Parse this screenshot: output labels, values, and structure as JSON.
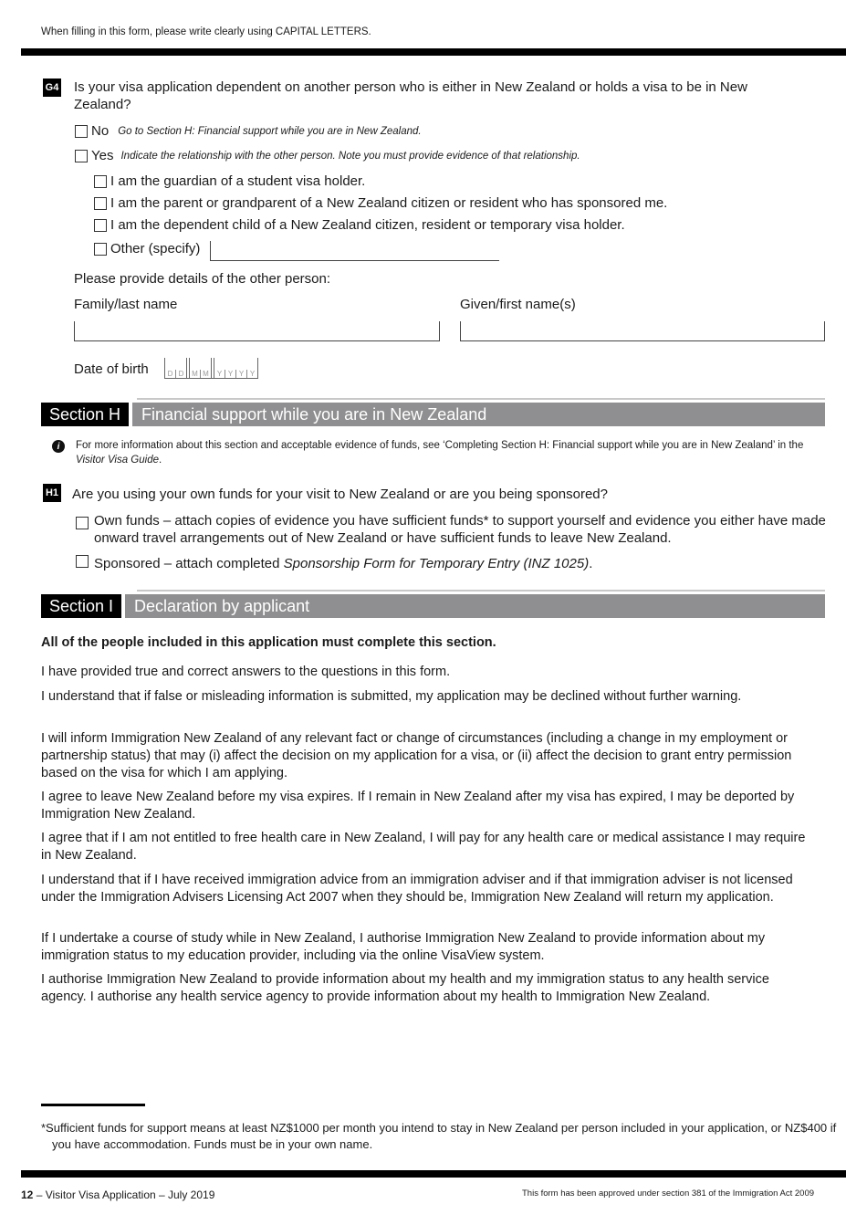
{
  "header": {
    "note": "When filling in this form, please write clearly using CAPITAL LETTERS."
  },
  "g4": {
    "badge": "G4",
    "question": "Is your visa application dependent on another person who is either in New Zealand or holds a visa to be in New Zealand?",
    "no_label": "No",
    "no_hint": "Go to Section H: Financial support while you are in New Zealand.",
    "yes_label": "Yes",
    "yes_hint": "Indicate the relationship with the other person. Note you must provide evidence of that relationship.",
    "options": [
      "I am the guardian of a student visa holder.",
      "I am the parent or grandparent of a New Zealand citizen or resident who has sponsored me.",
      "I am the dependent child of a New Zealand citizen, resident or temporary visa holder.",
      "Other (specify)"
    ],
    "other_value": "",
    "details_prompt": "Please provide details of the other person:",
    "family_name_label": "Family/last name",
    "family_name_value": "",
    "given_name_label": "Given/first name(s)",
    "given_name_value": "",
    "dob_label": "Date of birth",
    "dob_placeholders": [
      "D",
      "D",
      "M",
      "M",
      "Y",
      "Y",
      "Y",
      "Y"
    ]
  },
  "section_h": {
    "label": "Section H",
    "title": "Financial support while you are in New Zealand",
    "info_1": "For more information about this section and acceptable evidence of funds, see ‘Completing Section H: Financial support while you are in New Zealand’ in the ",
    "info_guide": "Visitor Visa Guide",
    "info_end": ".",
    "h1_badge": "H1",
    "h1_question": "Are you using your own funds for your visit to New Zealand or are you being sponsored?",
    "own_funds": "Own funds – attach copies of evidence you have sufficient funds* to support yourself and evidence you either have made onward travel arrangements out of New Zealand or have sufficient funds to leave New Zealand.",
    "sponsored_prefix": "Sponsored – attach completed ",
    "sponsored_form": "Sponsorship Form for Temporary Entry (INZ 1025)",
    "sponsored_end": "."
  },
  "section_i": {
    "label": "Section I",
    "title": "Declaration by applicant",
    "bold_note": "All of the people included in this application must complete this section.",
    "paragraphs": [
      "I have provided true and correct answers to the questions in this form.",
      "I understand that if false or misleading information is submitted, my application may be declined without further warning.",
      "I will inform Immigration New Zealand of any relevant fact or change of circumstances (including a change in my employment or partnership status) that may (i) affect the decision on my application for a visa, or (ii) affect the decision to grant entry permission based on the visa for which I am applying.",
      "I agree to leave New Zealand before my visa expires. If I remain in New Zealand after my visa has expired, I may be deported by Immigration New Zealand.",
      "I agree that if I am not entitled to free health care in New Zealand, I will pay for any health care or medical assistance I may require in New Zealand.",
      "I understand that if I have received immigration advice from an immigration adviser and if that immigration adviser is not licensed under the Immigration Advisers Licensing Act 2007 when they should be, Immigration New Zealand will return my application.",
      "If I undertake a course of study while in New Zealand, I authorise Immigration New Zealand to provide information about my immigration status to my education provider, including via the online VisaView system.",
      "I authorise Immigration New Zealand to provide information about my health and my immigration status to any health service agency. I authorise any health service agency to provide information about my health to Immigration New Zealand."
    ]
  },
  "footnote": "*Sufficient funds for support means at least NZ$1000 per month you intend to stay in New Zealand per person included in your application, or NZ$400 if you have accommodation. Funds must be in your own name.",
  "footer": {
    "page_number": "12",
    "doc_title": " – Visitor Visa Application – July 2019",
    "approval": "This form has been approved under section 381 of the Immigration Act 2009"
  }
}
